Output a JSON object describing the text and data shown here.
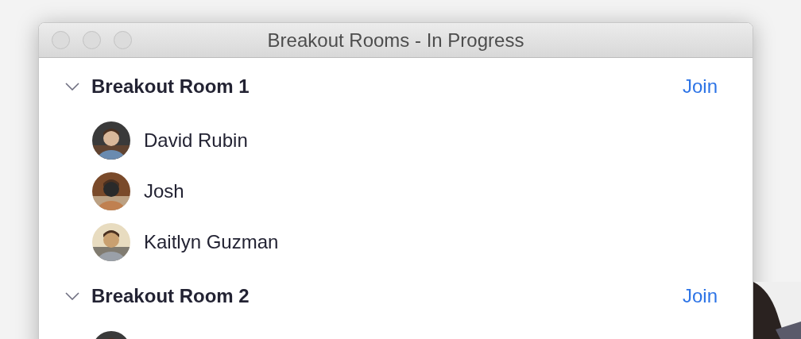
{
  "window": {
    "title": "Breakout Rooms - In Progress"
  },
  "rooms": [
    {
      "name": "Breakout Room 1",
      "expanded": true,
      "action": "Join",
      "participants": [
        {
          "name": "David Rubin",
          "kind": "picture"
        },
        {
          "name": "Josh",
          "kind": "picture"
        },
        {
          "name": "Kaitlyn Guzman",
          "kind": "picture"
        }
      ]
    },
    {
      "name": "Breakout Room 2",
      "expanded": true,
      "action": "Join"
    }
  ]
}
